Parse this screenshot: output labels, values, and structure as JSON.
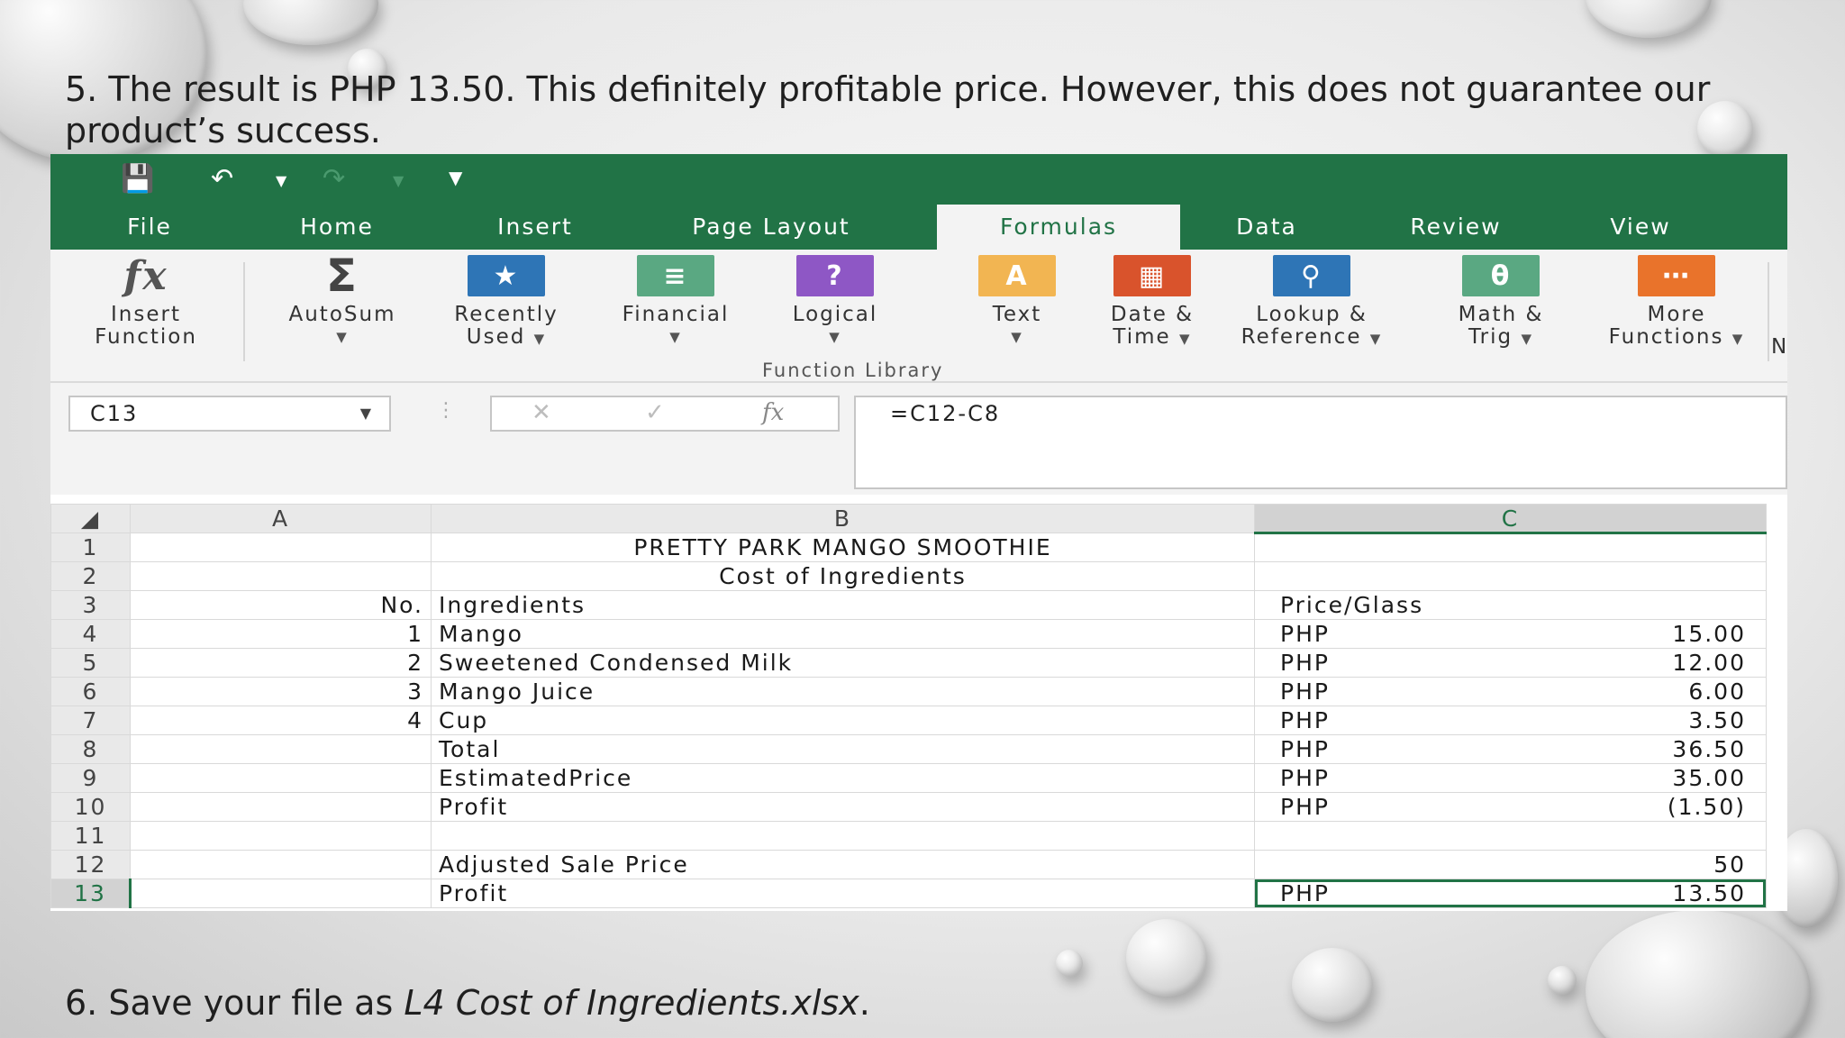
{
  "captions": {
    "top": "5. The result is PHP 13.50. This definitely profitable price. However, this does not guarantee our product’s success.",
    "bottom_prefix": "6.  Save your file as ",
    "bottom_filename": "L4 Cost of Ingredients.xlsx",
    "bottom_suffix": "."
  },
  "excel": {
    "tabs": [
      "File",
      "Home",
      "Insert",
      "Page Layout",
      "Formulas",
      "Data",
      "Review",
      "View"
    ],
    "active_tab": "Formulas",
    "ribbon_buttons": [
      {
        "line1": "Insert",
        "line2": "Function",
        "icon": "fx-icon"
      },
      {
        "line1": "AutoSum",
        "line2": "",
        "icon": "sigma-icon"
      },
      {
        "line1": "Recently",
        "line2": "Used",
        "icon": "star-book-icon"
      },
      {
        "line1": "Financial",
        "line2": "",
        "icon": "coins-book-icon"
      },
      {
        "line1": "Logical",
        "line2": "",
        "icon": "question-book-icon"
      },
      {
        "line1": "Text",
        "line2": "",
        "icon": "text-book-icon"
      },
      {
        "line1": "Date &",
        "line2": "Time",
        "icon": "calendar-book-icon"
      },
      {
        "line1": "Lookup &",
        "line2": "Reference",
        "icon": "magnifier-book-icon"
      },
      {
        "line1": "Math &",
        "line2": "Trig",
        "icon": "theta-book-icon"
      },
      {
        "line1": "More",
        "line2": "Functions",
        "icon": "dots-book-icon"
      }
    ],
    "group_label": "Function Library",
    "overflow_label": "N",
    "name_box": "C13",
    "formula": "=C12-C8",
    "columns": [
      "A",
      "B",
      "C"
    ],
    "selected_column": "C",
    "rows": [
      {
        "n": "1",
        "a": "",
        "b": "PRETTY PARK MANGO SMOOTHIE",
        "b_align": "center",
        "c_cur": "",
        "c_val": ""
      },
      {
        "n": "2",
        "a": "",
        "b": "Cost of Ingredients",
        "b_align": "center",
        "c_cur": "",
        "c_val": ""
      },
      {
        "n": "3",
        "a": "No.",
        "b": "Ingredients",
        "b_align": "left",
        "c_cur": "Price/Glass",
        "c_val": ""
      },
      {
        "n": "4",
        "a": "1",
        "b": "Mango",
        "b_align": "left",
        "c_cur": "PHP",
        "c_val": "15.00"
      },
      {
        "n": "5",
        "a": "2",
        "b": "Sweetened Condensed Milk",
        "b_align": "left",
        "c_cur": "PHP",
        "c_val": "12.00"
      },
      {
        "n": "6",
        "a": "3",
        "b": "Mango Juice",
        "b_align": "left",
        "c_cur": "PHP",
        "c_val": "6.00"
      },
      {
        "n": "7",
        "a": "4",
        "b": "Cup",
        "b_align": "left",
        "c_cur": "PHP",
        "c_val": "3.50"
      },
      {
        "n": "8",
        "a": "",
        "b": "Total",
        "b_align": "left",
        "c_cur": "PHP",
        "c_val": "36.50"
      },
      {
        "n": "9",
        "a": "",
        "b": "EstimatedPrice",
        "b_align": "left",
        "c_cur": "PHP",
        "c_val": "35.00"
      },
      {
        "n": "10",
        "a": "",
        "b": "Profit",
        "b_align": "left",
        "c_cur": "PHP",
        "c_val": "(1.50)"
      },
      {
        "n": "11",
        "a": "",
        "b": "",
        "b_align": "left",
        "c_cur": "",
        "c_val": ""
      },
      {
        "n": "12",
        "a": "",
        "b": "Adjusted Sale Price",
        "b_align": "left",
        "c_cur": "",
        "c_val": "50"
      },
      {
        "n": "13",
        "a": "",
        "b": "Profit",
        "b_align": "left",
        "c_cur": "PHP",
        "c_val": "13.50"
      }
    ],
    "active_cell_row": "13",
    "colors": {
      "excel_green": "#217346",
      "ribbon_bg": "#f3f3f3"
    }
  }
}
